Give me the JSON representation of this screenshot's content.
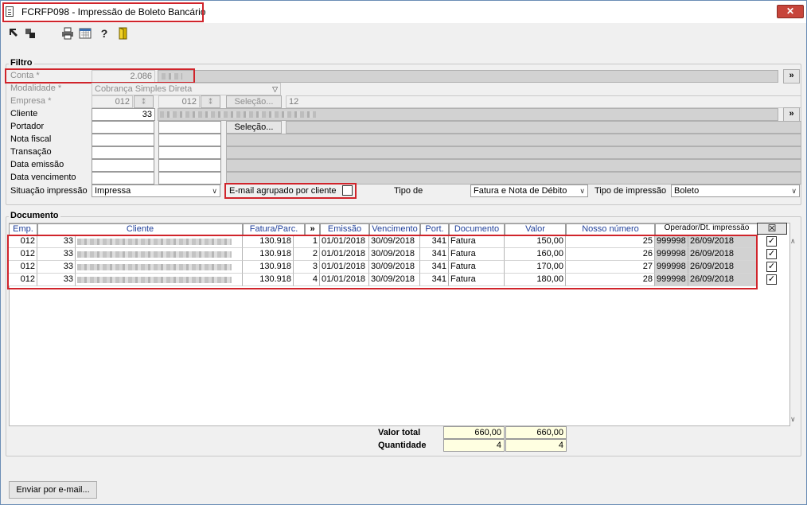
{
  "window": {
    "title": "FCRFP098 - Impressão de Boleto Bancário",
    "close_glyph": "✕"
  },
  "toolbar": {
    "icons": [
      "arrow-icon",
      "arrows-icon",
      "print-icon",
      "calendar-icon",
      "help-icon",
      "exit-door-icon"
    ]
  },
  "filtro": {
    "title": "Filtro",
    "conta": {
      "label": "Conta *",
      "value": "2.086"
    },
    "modalidade": {
      "label": "Modalidade *",
      "value": "Cobrança Simples Direta"
    },
    "empresa": {
      "label": "Empresa *",
      "value_from": "012",
      "value_to": "012",
      "selecao": "Seleção...",
      "count": "12"
    },
    "cliente": {
      "label": "Cliente",
      "value": "33"
    },
    "portador": {
      "label": "Portador",
      "selecao": "Seleção..."
    },
    "nota_fiscal": {
      "label": "Nota fiscal"
    },
    "transacao": {
      "label": "Transação"
    },
    "data_emissao": {
      "label": "Data emissão"
    },
    "data_vencimento": {
      "label": "Data vencimento"
    },
    "situacao": {
      "label": "Situação impressão",
      "value": "Impressa"
    },
    "email_agrupado": {
      "label": "E-mail agrupado por cliente",
      "checked": false
    },
    "tipo_de": {
      "label": "Tipo de",
      "value": "Fatura e Nota de Débito"
    },
    "tipo_impressao": {
      "label": "Tipo de impressão",
      "value": "Boleto"
    },
    "expand_glyph": "»"
  },
  "documento": {
    "title": "Documento",
    "columns": [
      "Emp.",
      "Cliente",
      "Fatura/Parc.",
      "»",
      "Emissão",
      "Vencimento",
      "Port.",
      "Documento",
      "Valor",
      "Nosso número",
      "Operador/Dt. impressão",
      "☒"
    ],
    "rows": [
      {
        "emp": "012",
        "cliente": "33",
        "fatura": "130.918",
        "parc": "1",
        "emissao": "01/01/2018",
        "vencimento": "30/09/2018",
        "port": "341",
        "documento": "Fatura",
        "valor": "150,00",
        "nosso": "25",
        "operador": "999998",
        "dt": "26/09/2018",
        "checked": true
      },
      {
        "emp": "012",
        "cliente": "33",
        "fatura": "130.918",
        "parc": "2",
        "emissao": "01/01/2018",
        "vencimento": "30/09/2018",
        "port": "341",
        "documento": "Fatura",
        "valor": "160,00",
        "nosso": "26",
        "operador": "999998",
        "dt": "26/09/2018",
        "checked": true
      },
      {
        "emp": "012",
        "cliente": "33",
        "fatura": "130.918",
        "parc": "3",
        "emissao": "01/01/2018",
        "vencimento": "30/09/2018",
        "port": "341",
        "documento": "Fatura",
        "valor": "170,00",
        "nosso": "27",
        "operador": "999998",
        "dt": "26/09/2018",
        "checked": true
      },
      {
        "emp": "012",
        "cliente": "33",
        "fatura": "130.918",
        "parc": "4",
        "emissao": "01/01/2018",
        "vencimento": "30/09/2018",
        "port": "341",
        "documento": "Fatura",
        "valor": "180,00",
        "nosso": "28",
        "operador": "999998",
        "dt": "26/09/2018",
        "checked": true
      }
    ],
    "totals": {
      "valor_label": "Valor total",
      "valor_1": "660,00",
      "valor_2": "660,00",
      "qtd_label": "Quantidade",
      "qtd_1": "4",
      "qtd_2": "4"
    }
  },
  "footer": {
    "email_button": "Enviar por e-mail..."
  }
}
